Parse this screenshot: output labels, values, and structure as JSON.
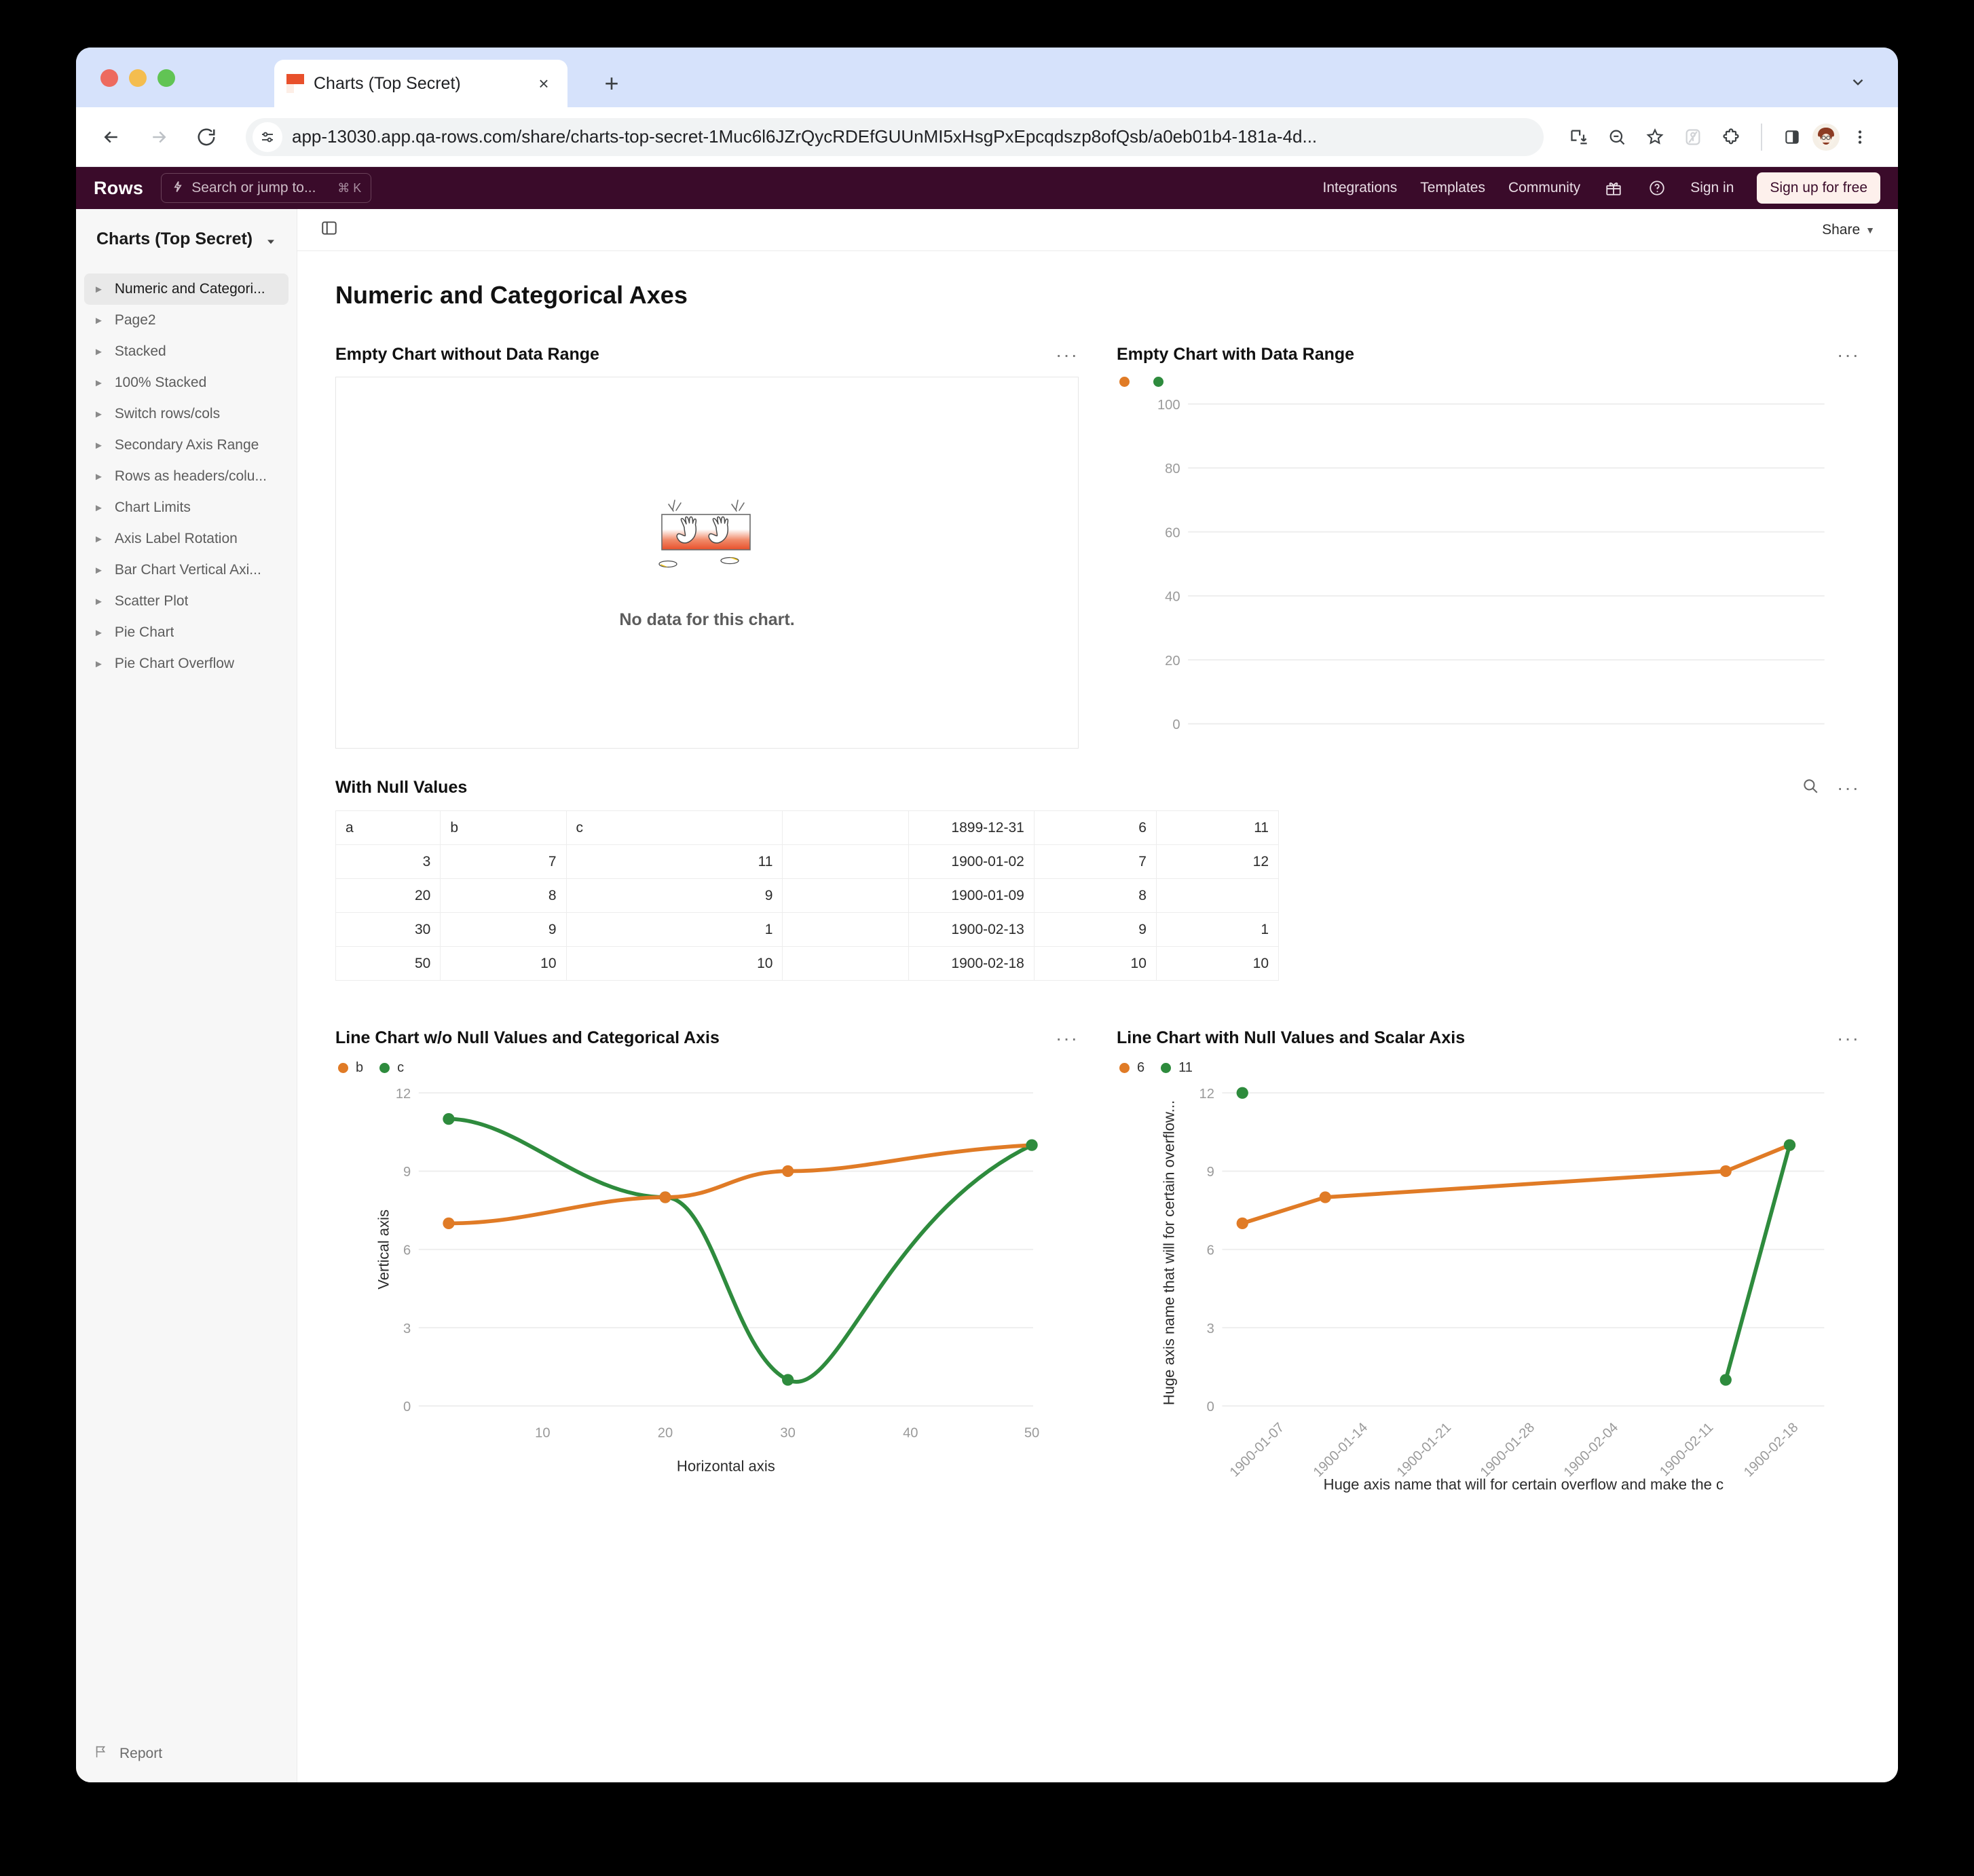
{
  "browser": {
    "tab_title": "Charts (Top Secret)",
    "url": "app-13030.app.qa-rows.com/share/charts-top-secret-1Muc6l6JZrQycRDEfGUUnMI5xHsgPxEpcqdszp8ofQsb/a0eb01b4-181a-4d...",
    "new_tab_label": "+",
    "close_label": "×"
  },
  "app_header": {
    "brand": "Rows",
    "search_placeholder": "Search or jump to...",
    "search_shortcut": "⌘ K",
    "links": [
      "Integrations",
      "Templates",
      "Community"
    ],
    "sign_in": "Sign in",
    "sign_up": "Sign up for free",
    "bg_color": "#3a0b2a"
  },
  "sidebar": {
    "doc_title": "Charts (Top Secret)",
    "items": [
      {
        "label": "Numeric and Categori...",
        "active": true
      },
      {
        "label": "Page2",
        "active": false
      },
      {
        "label": "Stacked",
        "active": false
      },
      {
        "label": "100% Stacked",
        "active": false
      },
      {
        "label": "Switch rows/cols",
        "active": false
      },
      {
        "label": "Secondary Axis Range",
        "active": false
      },
      {
        "label": "Rows as headers/colu...",
        "active": false
      },
      {
        "label": "Chart Limits",
        "active": false
      },
      {
        "label": "Axis Label Rotation",
        "active": false
      },
      {
        "label": "Bar Chart Vertical Axi...",
        "active": false
      },
      {
        "label": "Scatter Plot",
        "active": false
      },
      {
        "label": "Pie Chart",
        "active": false
      },
      {
        "label": "Pie Chart Overflow",
        "active": false
      }
    ],
    "report_label": "Report"
  },
  "toolbar": {
    "share_label": "Share"
  },
  "page": {
    "title": "Numeric and Categorical Axes"
  },
  "widgets": {
    "empty_no_range": {
      "title": "Empty Chart without Data Range",
      "empty_message": "No data for this chart."
    },
    "empty_with_range": {
      "title": "Empty Chart with Data Range"
    },
    "table": {
      "title": "With Null Values"
    },
    "line_categorical": {
      "title": "Line Chart w/o Null Values and Categorical Axis"
    },
    "line_scalar": {
      "title": "Line Chart with Null Values and Scalar Axis"
    }
  },
  "table_data": {
    "type": "table",
    "columns": [
      "a",
      "b",
      "c",
      "",
      "",
      "",
      ""
    ],
    "rows": [
      [
        "a",
        "b",
        "c",
        "",
        "1899-12-31",
        "6",
        "11"
      ],
      [
        "3",
        "7",
        "11",
        "",
        "1900-01-02",
        "7",
        "12"
      ],
      [
        "20",
        "8",
        "9",
        "",
        "1900-01-09",
        "8",
        ""
      ],
      [
        "30",
        "9",
        "1",
        "",
        "1900-02-13",
        "9",
        "1"
      ],
      [
        "50",
        "10",
        "10",
        "",
        "1900-02-18",
        "10",
        "10"
      ]
    ],
    "alignments": [
      "num",
      "num",
      "num",
      "num",
      "date",
      "num",
      "num"
    ],
    "header_alignments": [
      "txt",
      "txt",
      "txt",
      "txt",
      "date",
      "num",
      "num"
    ]
  },
  "colors": {
    "series_orange": "#e07b26",
    "series_green": "#2e8b3d",
    "grid": "#ededed",
    "axis_text": "#9a9a9a"
  },
  "chart_data": [
    {
      "id": "empty_with_range",
      "type": "line",
      "title": "Empty Chart with Data Range",
      "legend": [
        {
          "label": "",
          "color": "#e07b26"
        },
        {
          "label": "",
          "color": "#2e8b3d"
        }
      ],
      "series": [
        {
          "name": "",
          "values": []
        },
        {
          "name": "",
          "values": []
        }
      ],
      "x": [],
      "xlabel": "",
      "ylabel": "",
      "yticks": [
        0,
        20,
        40,
        60,
        80,
        100
      ],
      "ylim": [
        0,
        100
      ],
      "grid": true,
      "legend_position": "top-left"
    },
    {
      "id": "line_categorical",
      "type": "line",
      "title": "Line Chart w/o Null Values and Categorical Axis",
      "xlabel": "Horizontal axis",
      "ylabel": "Vertical axis",
      "categories": [
        3,
        20,
        30,
        50
      ],
      "xticks": [
        10,
        20,
        30,
        40,
        50
      ],
      "yticks": [
        0,
        3,
        6,
        9,
        12
      ],
      "ylim": [
        0,
        12
      ],
      "grid": true,
      "legend_position": "top-left",
      "series": [
        {
          "name": "b",
          "color": "#e07b26",
          "values": [
            7,
            8,
            9,
            10
          ]
        },
        {
          "name": "c",
          "color": "#2e8b3d",
          "values": [
            11,
            9,
            1,
            10
          ]
        }
      ]
    },
    {
      "id": "line_scalar",
      "type": "line",
      "title": "Line Chart with Null Values and Scalar Axis",
      "xlabel": "Huge axis name that will for certain overflow and make the c",
      "ylabel": "Huge axis name that will for certain overflow...",
      "xticks": [
        "1900-01-07",
        "1900-01-14",
        "1900-01-21",
        "1900-01-28",
        "1900-02-04",
        "1900-02-11",
        "1900-02-18"
      ],
      "yticks": [
        0,
        3,
        6,
        9,
        12
      ],
      "ylim": [
        0,
        12
      ],
      "grid": true,
      "legend_position": "top-left",
      "series": [
        {
          "name": "6",
          "color": "#e07b26",
          "points": [
            {
              "x": "1899-12-31",
              "y": 7
            },
            {
              "x": "1900-01-02",
              "y": 8
            },
            {
              "x": "1900-02-13",
              "y": 9
            },
            {
              "x": "1900-02-18",
              "y": 10
            }
          ]
        },
        {
          "name": "11",
          "color": "#2e8b3d",
          "points": [
            {
              "x": "1899-12-31",
              "y": 12
            },
            {
              "x": "1900-02-13",
              "y": 1
            },
            {
              "x": "1900-02-18",
              "y": 10
            }
          ]
        }
      ]
    }
  ]
}
